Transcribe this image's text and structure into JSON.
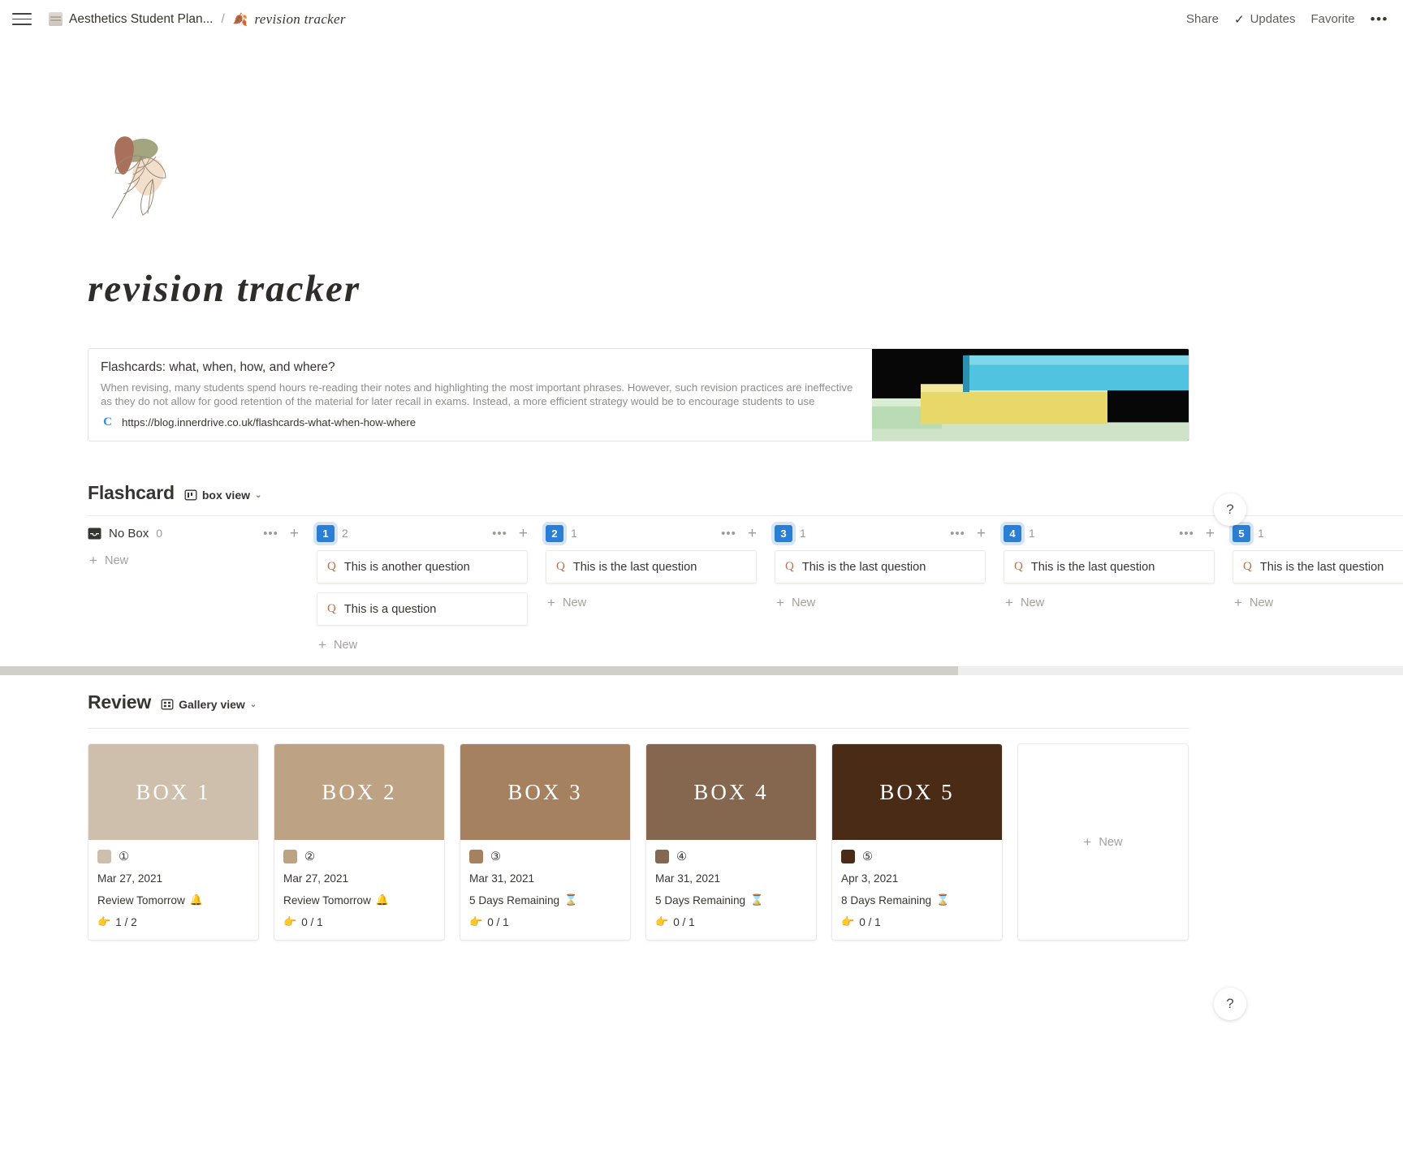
{
  "topbar": {
    "workspace_page": "Aesthetics Student Plan...",
    "separator": "/",
    "current_page": "revision tracker",
    "current_page_emoji": "🍂",
    "share_label": "Share",
    "updates_label": "Updates",
    "favorite_label": "Favorite",
    "more_label": "•••"
  },
  "page": {
    "title": "revision tracker"
  },
  "bookmark": {
    "title": "Flashcards: what, when, how, and where?",
    "description": "When revising, many students spend hours re-reading their notes and highlighting the most important phrases. However, such revision practices are ineffective as they do not allow for good retention of the material for later recall in exams. Instead, a more efficient strategy would be to encourage students to use flashcards (where students write",
    "url": "https://blog.innerdrive.co.uk/flashcards-what-when-how-where",
    "favicon_letter": "C"
  },
  "flashcard_section": {
    "title": "Flashcard",
    "view_label": "box view",
    "view_icon": "board-view-icon",
    "chevron": "⌄",
    "new_label": "New",
    "columns": [
      {
        "type": "nobox",
        "name": "No Box",
        "count": "0",
        "cards": []
      },
      {
        "type": "box",
        "badge": "1",
        "count": "2",
        "cards": [
          "This is another question",
          "This is a question"
        ]
      },
      {
        "type": "box",
        "badge": "2",
        "count": "1",
        "cards": [
          "This is the last question"
        ]
      },
      {
        "type": "box",
        "badge": "3",
        "count": "1",
        "cards": [
          "This is the last question"
        ]
      },
      {
        "type": "box",
        "badge": "4",
        "count": "1",
        "cards": [
          "This is the last question"
        ]
      },
      {
        "type": "box",
        "badge": "5",
        "count": "1",
        "cards": [
          "This is the last question"
        ]
      }
    ]
  },
  "review_section": {
    "title": "Review",
    "view_label": "Gallery view",
    "view_icon": "gallery-view-icon",
    "new_label": "New",
    "cards": [
      {
        "cover_label": "BOX 1",
        "cover_color": "#cdbfab",
        "swatch_color": "#cdbfab",
        "number": "①",
        "date": "Mar 27, 2021",
        "status": "Review Tomorrow",
        "status_emoji": "🔔",
        "progress": "1 / 2",
        "progress_emoji": "👉"
      },
      {
        "cover_label": "BOX 2",
        "cover_color": "#bda284",
        "swatch_color": "#bda284",
        "number": "②",
        "date": "Mar 27, 2021",
        "status": "Review Tomorrow",
        "status_emoji": "🔔",
        "progress": "0 / 1",
        "progress_emoji": "👉"
      },
      {
        "cover_label": "BOX 3",
        "cover_color": "#a68160",
        "swatch_color": "#a68160",
        "number": "③",
        "date": "Mar 31, 2021",
        "status": "5 Days Remaining",
        "status_emoji": "⌛",
        "progress": "0 / 1",
        "progress_emoji": "👉"
      },
      {
        "cover_label": "BOX 4",
        "cover_color": "#85674f",
        "swatch_color": "#85674f",
        "number": "④",
        "date": "Mar 31, 2021",
        "status": "5 Days Remaining",
        "status_emoji": "⌛",
        "progress": "0 / 1",
        "progress_emoji": "👉"
      },
      {
        "cover_label": "BOX 5",
        "cover_color": "#5a3venue",
        "swatch_color": "#4a2c16",
        "number": "⑤",
        "date": "Apr 3, 2021",
        "status": "8 Days Remaining",
        "status_emoji": "⌛",
        "progress": "0 / 1",
        "progress_emoji": "👉"
      }
    ]
  },
  "help": {
    "label": "?"
  },
  "colors": {
    "badge_blue": "#2a7fd4",
    "badge_halo": "#d3e5f7",
    "question_icon": "#b8724a",
    "box5_cover": "#4a2c16"
  }
}
